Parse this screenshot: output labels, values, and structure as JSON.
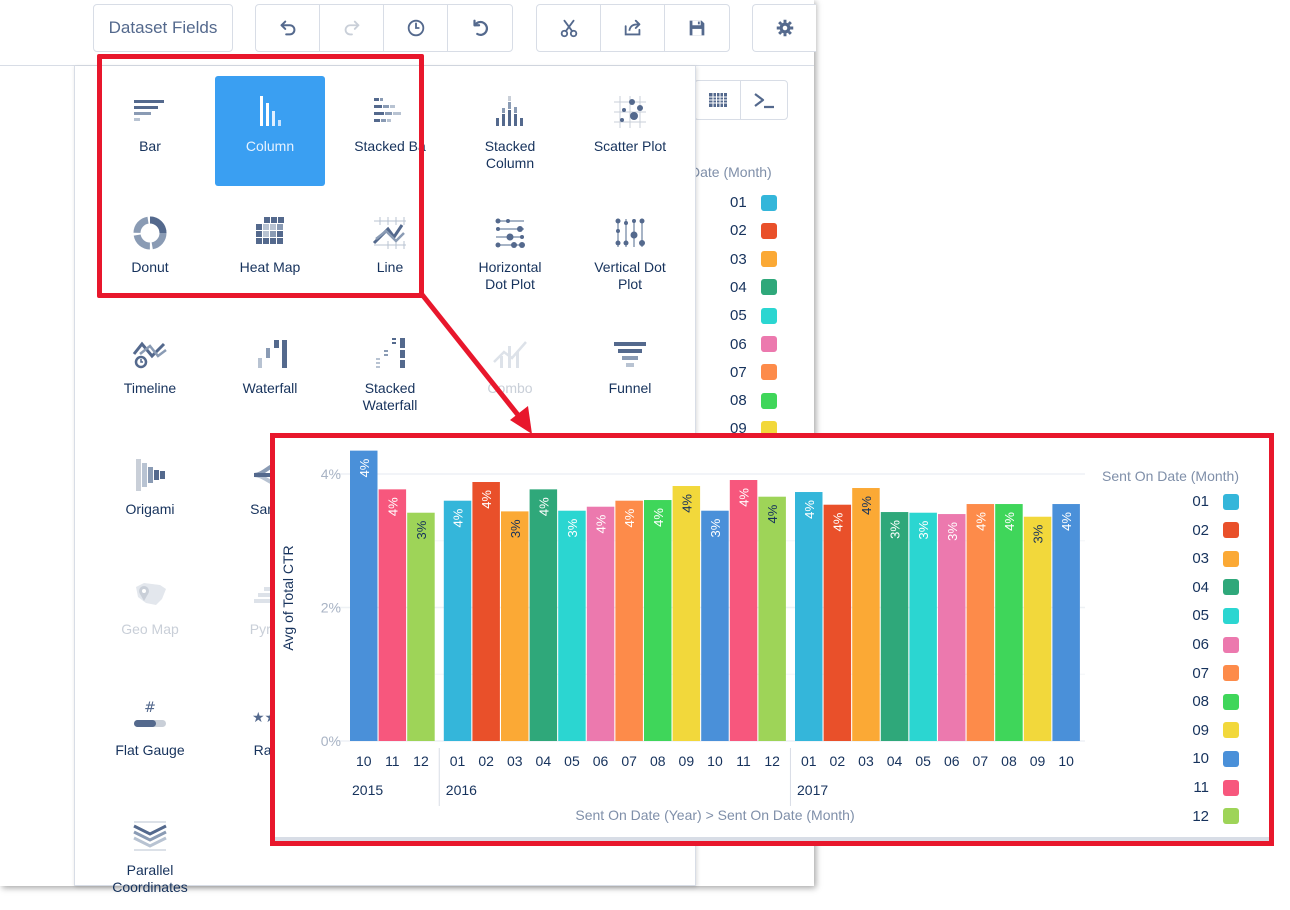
{
  "toolbar": {
    "dataset_fields_label": "Dataset Fields",
    "buttons": [
      "undo-icon",
      "redo-icon",
      "history-icon",
      "reset-icon",
      "cut-icon",
      "share-icon",
      "save-icon",
      "gear-icon"
    ]
  },
  "picker": {
    "chart_types": [
      {
        "label": "Bar",
        "icon": "bar-chart-icon",
        "state": "normal"
      },
      {
        "label": "Column",
        "icon": "column-chart-icon",
        "state": "selected"
      },
      {
        "label": "Stacked Ba",
        "icon": "stacked-bar-icon",
        "state": "normal"
      },
      {
        "label": "Stacked\nColumn",
        "icon": "stacked-column-icon",
        "state": "normal"
      },
      {
        "label": "Scatter Plot",
        "icon": "scatter-plot-icon",
        "state": "normal"
      },
      {
        "label": "Donut",
        "icon": "donut-icon",
        "state": "normal"
      },
      {
        "label": "Heat Map",
        "icon": "heat-map-icon",
        "state": "normal"
      },
      {
        "label": "Line",
        "icon": "line-chart-icon",
        "state": "normal"
      },
      {
        "label": "Horizontal\nDot Plot",
        "icon": "horizontal-dot-plot-icon",
        "state": "normal"
      },
      {
        "label": "Vertical Dot\nPlot",
        "icon": "vertical-dot-plot-icon",
        "state": "normal"
      },
      {
        "label": "Timeline",
        "icon": "timeline-icon",
        "state": "normal"
      },
      {
        "label": "Waterfall",
        "icon": "waterfall-icon",
        "state": "normal"
      },
      {
        "label": "Stacked\nWaterfall",
        "icon": "stacked-waterfall-icon",
        "state": "normal"
      },
      {
        "label": "Combo",
        "icon": "combo-icon",
        "state": "disabled"
      },
      {
        "label": "Funnel",
        "icon": "funnel-icon",
        "state": "normal"
      },
      {
        "label": "Origami",
        "icon": "origami-icon",
        "state": "normal"
      },
      {
        "label": "Sanke",
        "icon": "sankey-icon",
        "state": "normal"
      },
      {
        "label": "Geo Map",
        "icon": "geo-map-icon",
        "state": "disabled"
      },
      {
        "label": "Pyram",
        "icon": "pyramid-icon",
        "state": "disabled"
      },
      {
        "label": "Flat Gauge",
        "icon": "flat-gauge-icon",
        "state": "normal"
      },
      {
        "label": "Ratin",
        "icon": "rating-icon",
        "state": "normal"
      },
      {
        "label": "Parallel\nCoordinates",
        "icon": "parallel-coordinates-icon",
        "state": "normal"
      }
    ]
  },
  "right_panel": {
    "buttons": [
      "table-icon",
      "terminal-icon"
    ],
    "legend_title": "Date (Month)",
    "legend_items": [
      "01",
      "02",
      "03",
      "04",
      "05",
      "06",
      "07",
      "08",
      "09"
    ]
  },
  "colors": {
    "highlight": "#e8172c",
    "selected": "#3a9ff2",
    "months": {
      "01": "#34b6da",
      "02": "#e9502a",
      "03": "#fba935",
      "04": "#2fa87a",
      "05": "#2bd6d1",
      "06": "#ec79ae",
      "07": "#fd8b4a",
      "08": "#3fd65a",
      "09": "#f2d83b",
      "10": "#4a90d9",
      "11": "#f7577d",
      "12": "#9ed458"
    }
  },
  "chart_data": {
    "type": "bar",
    "title": "",
    "xlabel": "Sent On Date (Year) > Sent On Date (Month)",
    "ylabel": "Avg of Total CTR",
    "ylim": [
      0,
      4.4
    ],
    "yticks": [
      "0%",
      "2%",
      "4%"
    ],
    "ytick_values": [
      0,
      2,
      4
    ],
    "grid": true,
    "legend_title": "Sent On Date (Month)",
    "legend_position": "right",
    "legend": [
      "01",
      "02",
      "03",
      "04",
      "05",
      "06",
      "07",
      "08",
      "09",
      "10",
      "11",
      "12"
    ],
    "groups": [
      {
        "year": "2015",
        "months": [
          "10",
          "11",
          "12"
        ],
        "values": [
          4.35,
          3.77,
          3.42
        ],
        "labels": [
          "4%",
          "4%",
          "3%"
        ]
      },
      {
        "year": "2016",
        "months": [
          "01",
          "02",
          "03",
          "04",
          "05",
          "06",
          "07",
          "08",
          "09",
          "10",
          "11",
          "12"
        ],
        "values": [
          3.6,
          3.88,
          3.44,
          3.77,
          3.45,
          3.51,
          3.6,
          3.61,
          3.82,
          3.45,
          3.91,
          3.66
        ],
        "labels": [
          "4%",
          "4%",
          "3%",
          "4%",
          "3%",
          "4%",
          "4%",
          "4%",
          "4%",
          "3%",
          "4%",
          "4%"
        ]
      },
      {
        "year": "2017",
        "months": [
          "01",
          "02",
          "03",
          "04",
          "05",
          "06",
          "07",
          "08",
          "09",
          "10"
        ],
        "values": [
          3.73,
          3.54,
          3.79,
          3.43,
          3.42,
          3.4,
          3.55,
          3.55,
          3.36,
          3.55
        ],
        "labels": [
          "4%",
          "4%",
          "4%",
          "3%",
          "3%",
          "3%",
          "4%",
          "4%",
          "3%",
          "4%"
        ]
      }
    ]
  }
}
